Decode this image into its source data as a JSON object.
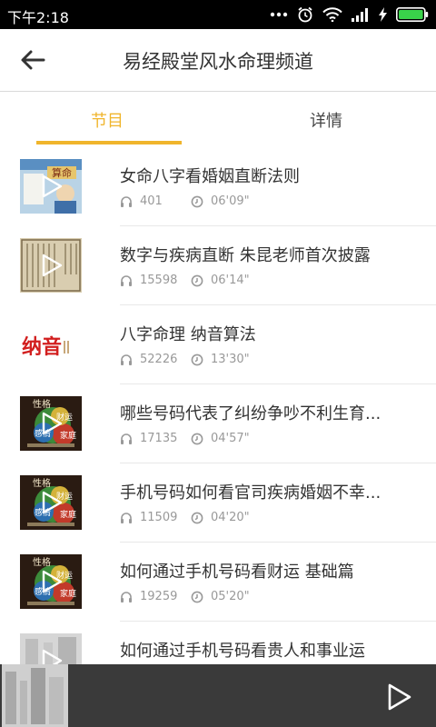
{
  "status": {
    "time": "下午2:18",
    "icons": [
      "more-dots-icon",
      "alarm-icon",
      "wifi-icon",
      "signal-icon",
      "charging-icon",
      "battery-icon"
    ]
  },
  "header": {
    "title": "易经殿堂风水命理频道",
    "back_icon": "back-arrow-icon"
  },
  "tabs": [
    {
      "label": "节目",
      "active": true
    },
    {
      "label": "详情",
      "active": false
    }
  ],
  "colors": {
    "accent": "#f0b52c",
    "text": "#333333",
    "meta": "#999999",
    "bottom_bar": "#3a3a3a"
  },
  "episodes": [
    {
      "title": "女命八字看婚姻直断法则",
      "plays": "401",
      "duration": "06'09\""
    },
    {
      "title": "数字与疾病直断 朱昆老师首次披露",
      "plays": "15598",
      "duration": "06'14\""
    },
    {
      "title": "八字命理 纳音算法",
      "plays": "52226",
      "duration": "13'30\""
    },
    {
      "title": "哪些号码代表了纠纷争吵不利生育...",
      "plays": "17135",
      "duration": "04'57\""
    },
    {
      "title": "手机号码如何看官司疾病婚姻不幸...",
      "plays": "11509",
      "duration": "04'20\""
    },
    {
      "title": "如何通过手机号码看财运 基础篇",
      "plays": "19259",
      "duration": "05'20\""
    },
    {
      "title": "如何通过手机号码看贵人和事业运",
      "plays": "",
      "duration": ""
    }
  ],
  "thumb_text": {
    "ep1": "算命",
    "ep3": "纳音",
    "ep4": [
      "性格",
      "财运",
      "感情",
      "家庭"
    ],
    "ep5": [
      "性格",
      "财运",
      "感情",
      "家庭"
    ],
    "ep6": [
      "性格",
      "财运",
      "感情",
      "家庭"
    ]
  },
  "player": {
    "play_icon": "play-icon"
  }
}
